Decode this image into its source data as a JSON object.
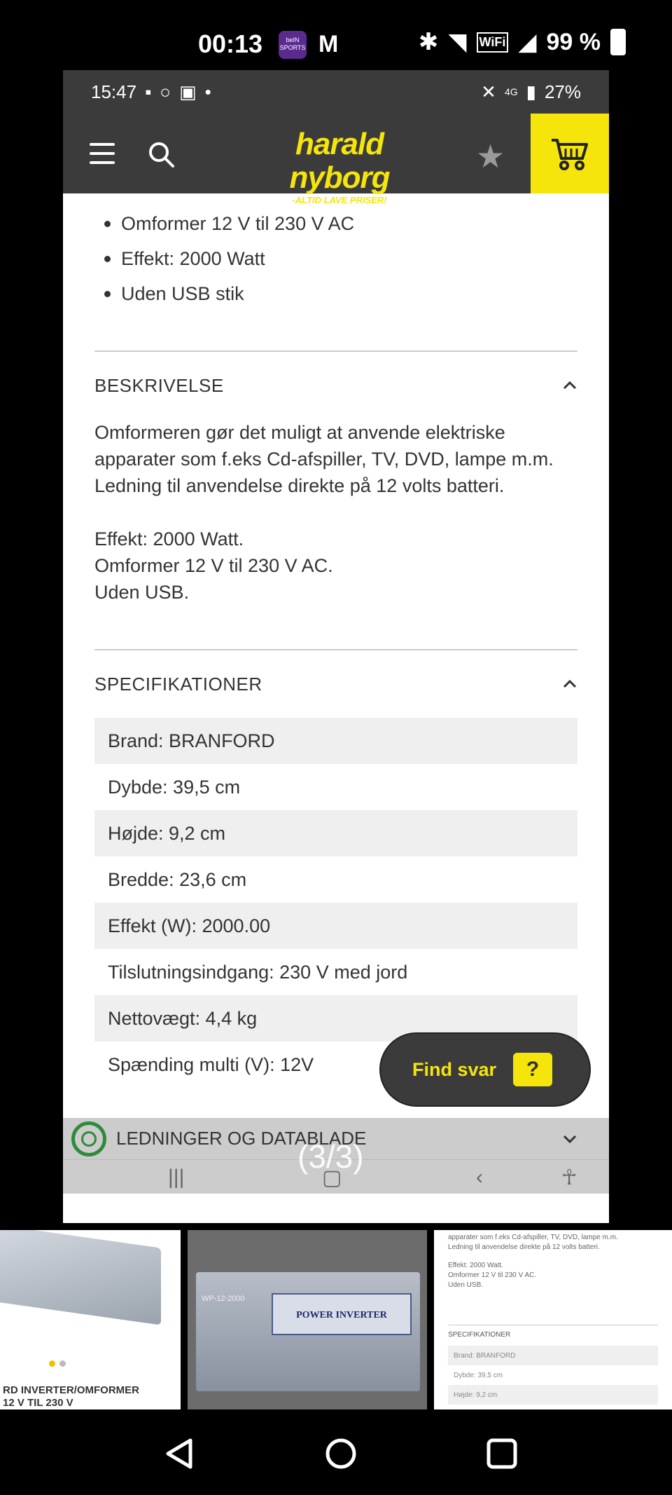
{
  "outer_status": {
    "time": "00:13",
    "battery": "99 %",
    "bein_label": "beIN SPORTS"
  },
  "inner_status": {
    "time": "15:47",
    "battery": "27%",
    "network": "4G"
  },
  "header": {
    "logo_name": "harald nyborg",
    "logo_tagline": "-ALTID LAVE PRISER!"
  },
  "bullets": [
    "Omformer 12 V til 230 V AC",
    "Effekt: 2000 Watt",
    "Uden USB stik"
  ],
  "description": {
    "title": "BESKRIVELSE",
    "paragraph1": "Omformeren gør det muligt at anvende elektriske apparater som f.eks Cd-afspiller, TV, DVD, lampe m.m. Ledning til anvendelse direkte på 12 volts batteri.",
    "line1": "Effekt: 2000 Watt.",
    "line2": "Omformer 12 V til 230 V AC.",
    "line3": "Uden USB."
  },
  "specifications": {
    "title": "SPECIFIKATIONER",
    "rows": [
      "Brand: BRANFORD",
      "Dybde: 39,5 cm",
      "Højde: 9,2 cm",
      "Bredde: 23,6 cm",
      "Effekt (W): 2000.00",
      "Tilslutningsindgang: 230 V med jord",
      "Nettovægt: 4,4 kg",
      "Spænding multi (V): 12V"
    ]
  },
  "find_svar": {
    "label": "Find svar",
    "icon_text": "?"
  },
  "manuals": {
    "title": "LEDNINGER OG DATABLADE"
  },
  "viewer": {
    "counter": "(3/3)"
  },
  "thumbnails": {
    "t1_caption_line1": "RD INVERTER/OMFORMER",
    "t1_caption_line2": "12 V TIL 230 V",
    "t2_label": "POWER INVERTER",
    "t2_model": "WP-12-2000",
    "t3_text1": "apparater som f.eks Cd-afspiller, TV, DVD, lampe m.m.",
    "t3_text2": "Ledning til anvendelse direkte på 12 volts batteri.",
    "t3_text3": "Effekt: 2000 Watt.",
    "t3_text4": "Omformer 12 V til 230 V AC.",
    "t3_text5": "Uden USB.",
    "t3_spec_title": "SPECIFIKATIONER",
    "t3_rows": [
      "Brand: BRANFORD",
      "Dybde: 39,5 cm",
      "Højde: 9,2 cm"
    ]
  }
}
